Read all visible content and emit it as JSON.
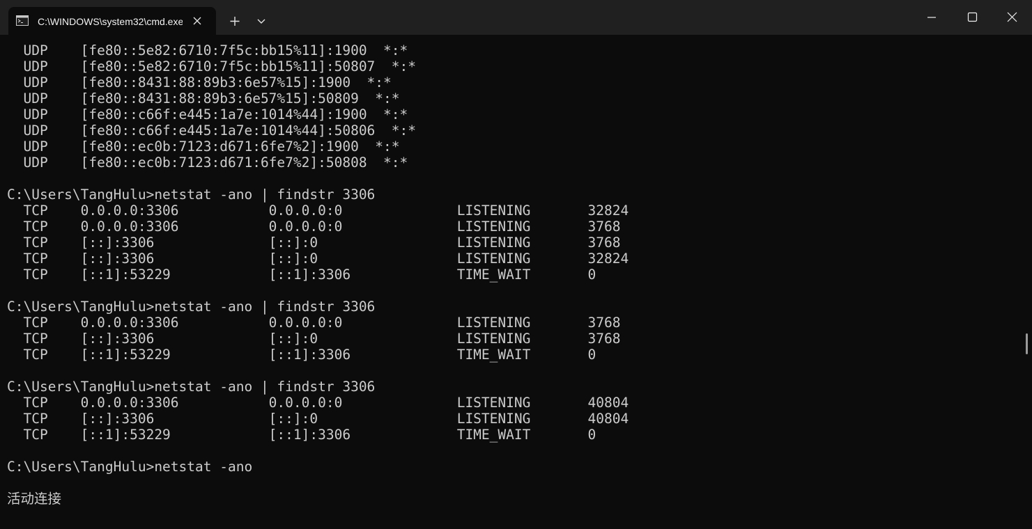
{
  "window": {
    "tab_title": "C:\\WINDOWS\\system32\\cmd.exe",
    "tab_icon": "cmd-icon",
    "new_tab_icon": "plus-icon",
    "dropdown_icon": "chevron-down-icon",
    "minimize_icon": "minimize-icon",
    "maximize_icon": "maximize-icon",
    "close_icon": "close-icon",
    "colors": {
      "titlebar_bg": "#202020",
      "terminal_bg": "#0c0c0c",
      "terminal_fg": "#cccccc"
    }
  },
  "terminal": {
    "lines": [
      "  UDP    [fe80::5e82:6710:7f5c:bb15%11]:1900  *:*",
      "  UDP    [fe80::5e82:6710:7f5c:bb15%11]:50807  *:*",
      "  UDP    [fe80::8431:88:89b3:6e57%15]:1900  *:*",
      "  UDP    [fe80::8431:88:89b3:6e57%15]:50809  *:*",
      "  UDP    [fe80::c66f:e445:1a7e:1014%44]:1900  *:*",
      "  UDP    [fe80::c66f:e445:1a7e:1014%44]:50806  *:*",
      "  UDP    [fe80::ec0b:7123:d671:6fe7%2]:1900  *:*",
      "  UDP    [fe80::ec0b:7123:d671:6fe7%2]:50808  *:*",
      "",
      "C:\\Users\\TangHulu>netstat -ano | findstr 3306",
      "  TCP    0.0.0.0:3306           0.0.0.0:0              LISTENING       32824",
      "  TCP    0.0.0.0:3306           0.0.0.0:0              LISTENING       3768",
      "  TCP    [::]:3306              [::]:0                 LISTENING       3768",
      "  TCP    [::]:3306              [::]:0                 LISTENING       32824",
      "  TCP    [::1]:53229            [::1]:3306             TIME_WAIT       0",
      "",
      "C:\\Users\\TangHulu>netstat -ano | findstr 3306",
      "  TCP    0.0.0.0:3306           0.0.0.0:0              LISTENING       3768",
      "  TCP    [::]:3306              [::]:0                 LISTENING       3768",
      "  TCP    [::1]:53229            [::1]:3306             TIME_WAIT       0",
      "",
      "C:\\Users\\TangHulu>netstat -ano | findstr 3306",
      "  TCP    0.0.0.0:3306           0.0.0.0:0              LISTENING       40804",
      "  TCP    [::]:3306              [::]:0                 LISTENING       40804",
      "  TCP    [::1]:53229            [::1]:3306             TIME_WAIT       0",
      "",
      "C:\\Users\\TangHulu>netstat -ano",
      "",
      "活动连接"
    ]
  }
}
